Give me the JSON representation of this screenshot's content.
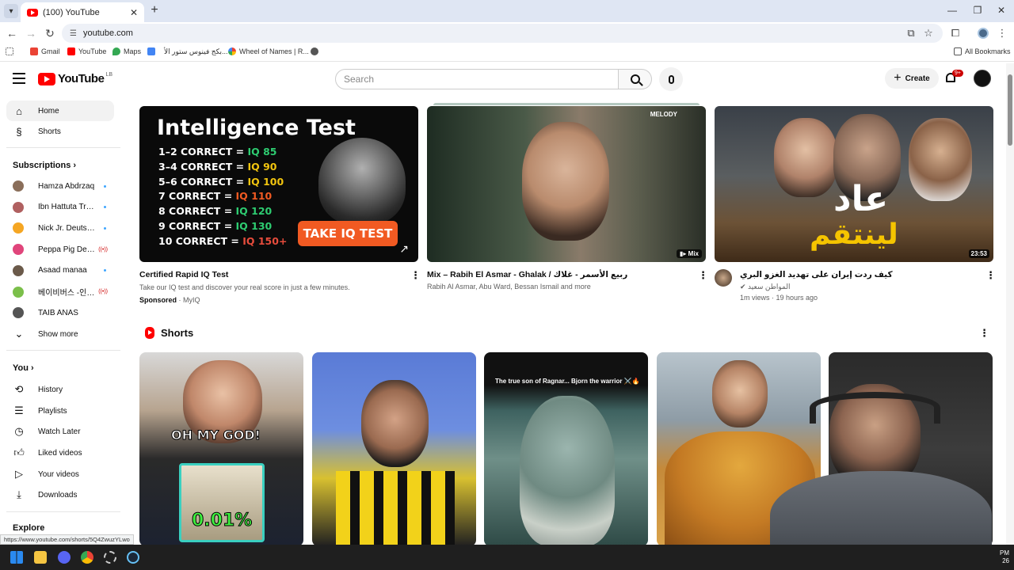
{
  "browser": {
    "tab_title": "(100) YouTube",
    "url": "youtube.com",
    "bookmarks": [
      "Gmail",
      "YouTube",
      "Maps",
      "",
      "بكج فينوس ستور الأ...",
      "Wheel of Names | R...",
      ""
    ],
    "all_bookmarks": "All Bookmarks"
  },
  "masthead": {
    "logo_text": "YouTube",
    "region": "LB",
    "search_placeholder": "Search",
    "create_label": "Create",
    "notifications_badge": "9+"
  },
  "sidebar": {
    "home": "Home",
    "shorts": "Shorts",
    "subscriptions_title": "Subscriptions",
    "subscriptions": [
      {
        "name": "Hamza Abdrzaq",
        "status": "dot",
        "color": "#8a6e5a"
      },
      {
        "name": "Ibn Hattuta Trav...",
        "status": "dot",
        "color": "#b06060"
      },
      {
        "name": "Nick Jr. Deutschl...",
        "status": "dot",
        "color": "#f5a623"
      },
      {
        "name": "Peppa Pig Deuts...",
        "status": "live",
        "color": "#e0457b"
      },
      {
        "name": "Asaad manaa",
        "status": "dot",
        "color": "#6b5a4a"
      },
      {
        "name": "베이비버스 -인기...",
        "status": "live",
        "color": "#7bbf4a"
      },
      {
        "name": "TAIB ANAS",
        "status": "",
        "color": "#555555"
      }
    ],
    "show_more": "Show more",
    "you_title": "You",
    "you_items": [
      "History",
      "Playlists",
      "Watch Later",
      "Liked videos",
      "Your videos",
      "Downloads"
    ],
    "explore_title": "Explore"
  },
  "videos": [
    {
      "title": "Certified Rapid IQ Test",
      "meta1": "Take our IQ test and discover your real score in just a few minutes.",
      "sponsored": "Sponsored",
      "advertiser": "· MyIQ",
      "thumb": {
        "headline": "Intelligence Test",
        "rows": [
          {
            "left": "1–2 CORRECT = ",
            "right": "IQ 85",
            "color": "#2ecc71"
          },
          {
            "left": "3–4 CORRECT = ",
            "right": "IQ 90",
            "color": "#f1c40f"
          },
          {
            "left": "5–6 CORRECT = ",
            "right": "IQ 100",
            "color": "#f1c40f"
          },
          {
            "left": "7 CORRECT = ",
            "right": "IQ 110",
            "color": "#f15a22"
          },
          {
            "left": "8 CORRECT = ",
            "right": "IQ 120",
            "color": "#2ecc71"
          },
          {
            "left": "9 CORRECT = ",
            "right": "IQ 130",
            "color": "#2ecc71"
          },
          {
            "left": "10 CORRECT = ",
            "right": "IQ 150+",
            "color": "#e74c3c"
          }
        ],
        "cta": "TAKE IQ TEST"
      }
    },
    {
      "title": "Mix – Rabih El Asmar - Ghalak / ربيع الأسمر - غلاك",
      "meta1": "Rabih Al Asmar, Abu Ward, Bessan Ismail and more",
      "badge": "Mix",
      "watermark": "MELODY"
    },
    {
      "title": "كيف ردت إيران على تهديد الغزو البري",
      "channel": "المواطن سعيد",
      "meta2": "1m views · 19 hours ago",
      "duration": "23:53",
      "thumb_text_1": "عاد",
      "thumb_text_2": "لينتقم"
    }
  ],
  "shorts": {
    "title": "Shorts",
    "items": [
      {
        "overlay": "OH MY GOD!",
        "overlay2": "0.01%"
      },
      {
        "overlay": ""
      },
      {
        "overlay": "The true son of Ragnar... Bjorn the warrior ⚔️🔥"
      },
      {
        "overlay": ""
      },
      {
        "overlay": ""
      }
    ]
  },
  "status_url": "https://www.youtube.com/shorts/5Q4ZwuzYLwo",
  "taskbar": {
    "clock_1": "PM",
    "clock_2": "26"
  },
  "colors": {
    "yt_red": "#ff0000",
    "accent_blue": "#3ea6ff"
  }
}
